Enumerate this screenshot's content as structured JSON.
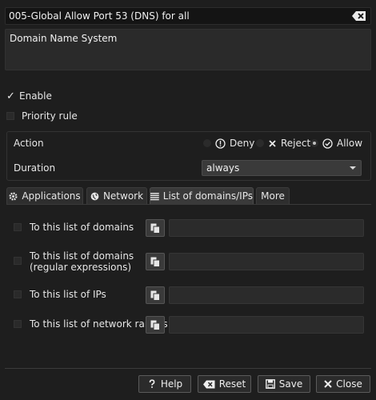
{
  "rule": {
    "name": "005-Global Allow Port 53 (DNS) for all",
    "description": "Domain Name System"
  },
  "options": {
    "enable_label": "Enable",
    "enable_checked": true,
    "priority_label": "Priority rule",
    "priority_checked": false
  },
  "action": {
    "label": "Action",
    "deny": "Deny",
    "reject": "Reject",
    "allow": "Allow",
    "selected": "Allow"
  },
  "duration": {
    "label": "Duration",
    "value": "always"
  },
  "tabs": [
    {
      "label": "Applications",
      "icon": "gear-icon"
    },
    {
      "label": "Network",
      "icon": "globe-icon"
    },
    {
      "label": "List of domains/IPs",
      "icon": "list-icon",
      "active": true
    },
    {
      "label": "More"
    }
  ],
  "lists": [
    {
      "label": "To this list of domains",
      "value": ""
    },
    {
      "label": "To this list of domains\n(regular expressions)",
      "value": ""
    },
    {
      "label": "To this list of IPs",
      "value": ""
    },
    {
      "label": "To this list of network ranges",
      "value": ""
    }
  ],
  "footer": {
    "help": "Help",
    "reset": "Reset",
    "save": "Save",
    "close": "Close"
  },
  "colors": {
    "background": "#1e1e1e",
    "field": "#2a2a2a",
    "text": "#e6e6e6"
  }
}
